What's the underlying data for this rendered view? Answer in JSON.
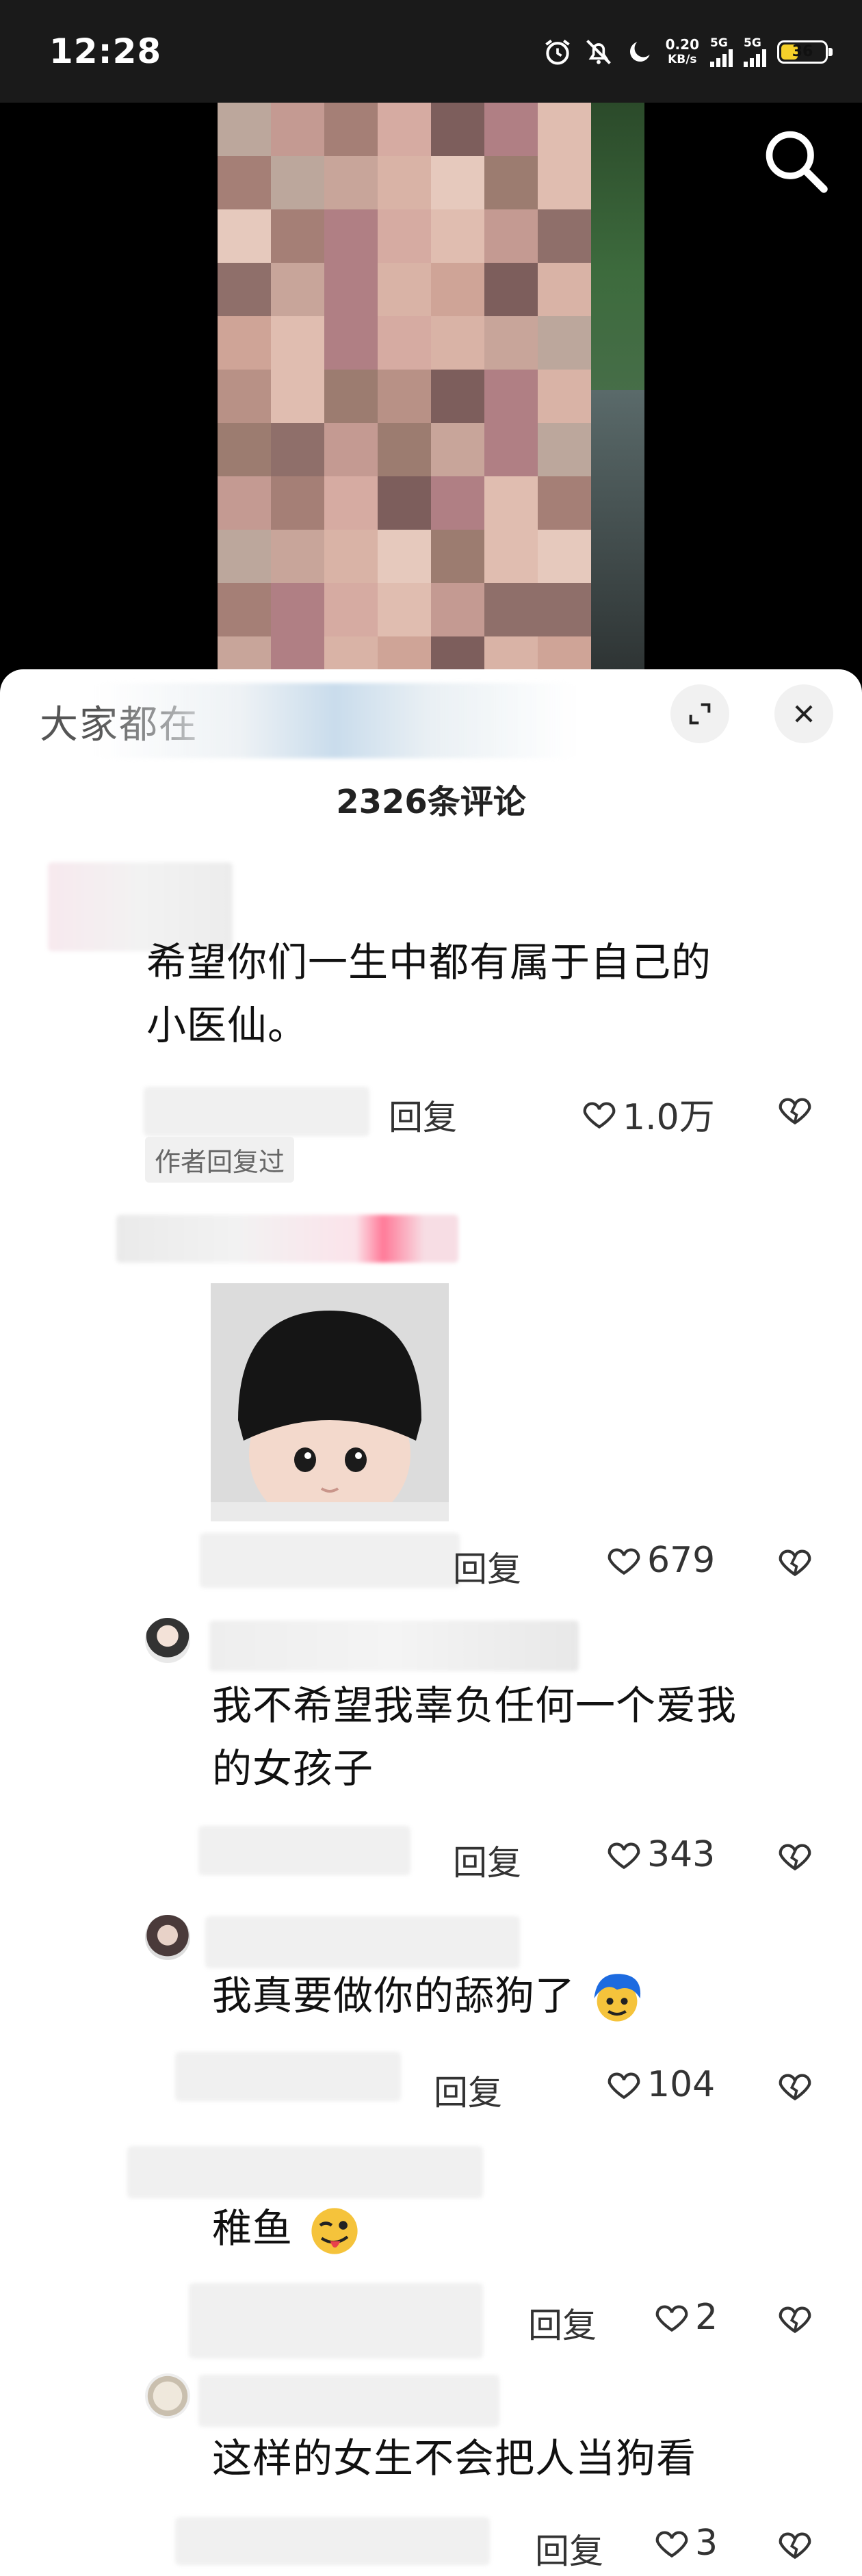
{
  "status_bar": {
    "time": "12:28",
    "net_speed_value": "0.20",
    "net_speed_unit": "KB/s",
    "sim1_label": "5G",
    "sim2_label": "5G",
    "battery": "36",
    "icons": [
      "alarm-icon",
      "mute-icon",
      "moon-icon"
    ]
  },
  "video": {
    "search_icon": "search-icon"
  },
  "sheet": {
    "title": "大家都在",
    "comment_count": "2326条评论",
    "expand_icon": "expand-icon",
    "close_icon": "close-icon"
  },
  "comments": [
    {
      "text_line1": "希望你们一生中都有属于自己的",
      "text_line2": "小医仙。",
      "reply": "回复",
      "likes": "1.0万",
      "author_tag": "作者回复过"
    },
    {
      "reply": "回复",
      "likes": "679",
      "has_sticker": true
    },
    {
      "text_line1": "我不希望我辜负任何一个爱我",
      "text_line2": "的女孩子",
      "reply": "回复",
      "likes": "343"
    },
    {
      "text_line1": "我真要做你的舔狗了",
      "reply": "回复",
      "likes": "104",
      "emoji": "blue-hair-face-emoji"
    },
    {
      "text_line1": "稚鱼",
      "reply": "回复",
      "likes": "2",
      "emoji": "wink-tongue-emoji"
    },
    {
      "text_line1": "这样的女生不会把人当狗看",
      "reply": "回复",
      "likes": "3"
    }
  ],
  "colors": {
    "accent_pink": "#ff6f91",
    "like_gray": "#333333"
  }
}
